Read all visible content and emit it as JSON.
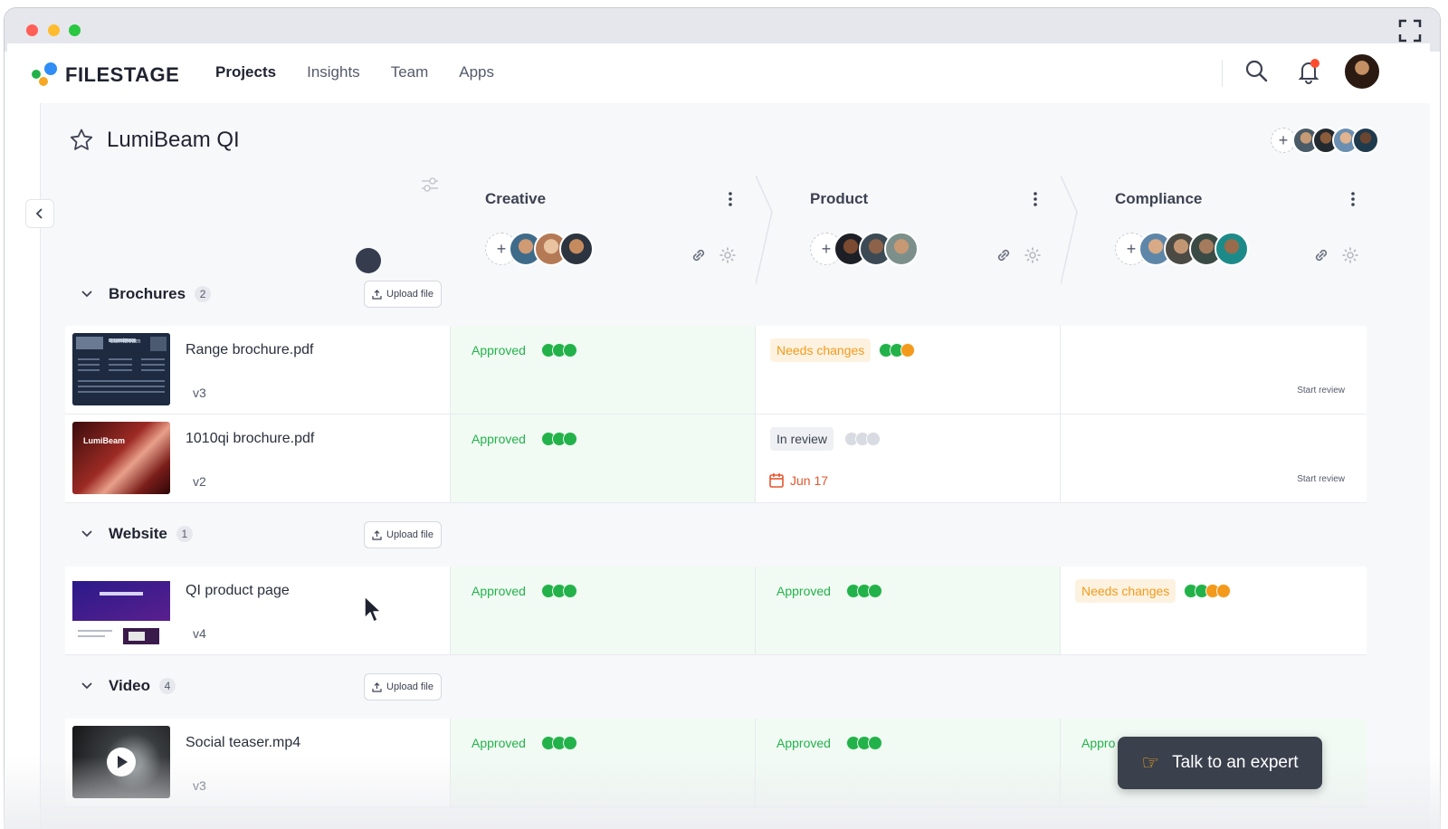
{
  "brand": {
    "name": "FILESTAGE"
  },
  "nav": {
    "items": [
      "Projects",
      "Insights",
      "Team",
      "Apps"
    ],
    "active": "Projects"
  },
  "project": {
    "title": "LumiBeam QI"
  },
  "stages": [
    {
      "title": "Creative"
    },
    {
      "title": "Product"
    },
    {
      "title": "Compliance"
    }
  ],
  "groups": [
    {
      "name": "Brochures",
      "count": "2",
      "upload_label": "Upload file"
    },
    {
      "name": "Website",
      "count": "1",
      "upload_label": "Upload file"
    },
    {
      "name": "Video",
      "count": "4",
      "upload_label": "Upload file"
    }
  ],
  "files": [
    {
      "name": "Range brochure.pdf",
      "version": "v3",
      "creative": {
        "status": "Approved"
      },
      "product": {
        "status": "Needs changes"
      },
      "compliance": {
        "action": "Start review"
      }
    },
    {
      "name": "1010qi brochure.pdf",
      "version": "v2",
      "creative": {
        "status": "Approved"
      },
      "product": {
        "status": "In review",
        "due": "Jun 17"
      },
      "compliance": {
        "action": "Start review"
      }
    },
    {
      "name": "QI product page",
      "version": "v4",
      "creative": {
        "status": "Approved"
      },
      "product": {
        "status": "Approved"
      },
      "compliance": {
        "status": "Needs changes"
      }
    },
    {
      "name": "Social teaser.mp4",
      "version": "v3",
      "creative": {
        "status": "Approved"
      },
      "product": {
        "status": "Approved"
      },
      "compliance": {
        "status": "Appro"
      }
    }
  ],
  "thumbnails": {
    "brand_label": "LumiBeam"
  },
  "cta": {
    "label": "Talk to an expert"
  },
  "colors": {
    "approved": "#23b24a",
    "needs_changes": "#f39a1c",
    "due": "#e4572e",
    "cta_bg": "#3a404c"
  }
}
